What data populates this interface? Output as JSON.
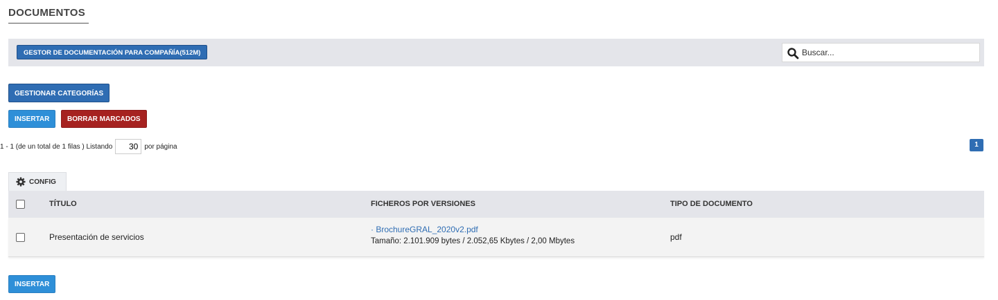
{
  "page": {
    "title": "DOCUMENTOS"
  },
  "toolbar": {
    "company_button": "GESTOR DE DOCUMENTACIÓN PARA COMPAÑÍA(512M)",
    "search_placeholder": "Buscar..."
  },
  "actions": {
    "manage_categories": "GESTIONAR CATEGORÍAS",
    "insert": "INSERTAR",
    "delete_marked": "BORRAR MARCADOS",
    "insert_bottom": "INSERTAR"
  },
  "pagination": {
    "range_text": "1 - 1 (de un total de 1 filas ) Listando",
    "per_page_value": "30",
    "per_page_suffix": "por página",
    "current_page": "1"
  },
  "config_tab": {
    "label": "CONFIG",
    "icon": "gear-icon"
  },
  "table": {
    "columns": [
      "TÍTULO",
      "FICHEROS POR VERSIONES",
      "TIPO DE DOCUMENTO"
    ],
    "rows": [
      {
        "title": "Presentación de servicios",
        "file_link": "· BrochureGRAL_2020v2.pdf",
        "file_size": "Tamaño: 2.101.909 bytes / 2.052,65 Kbytes / 2,00 Mbytes",
        "doc_type": "pdf"
      }
    ]
  },
  "colors": {
    "primary": "#2f6db3",
    "insert": "#2e8fd8",
    "danger": "#a62220",
    "bar_bg": "#e4e5ea"
  }
}
